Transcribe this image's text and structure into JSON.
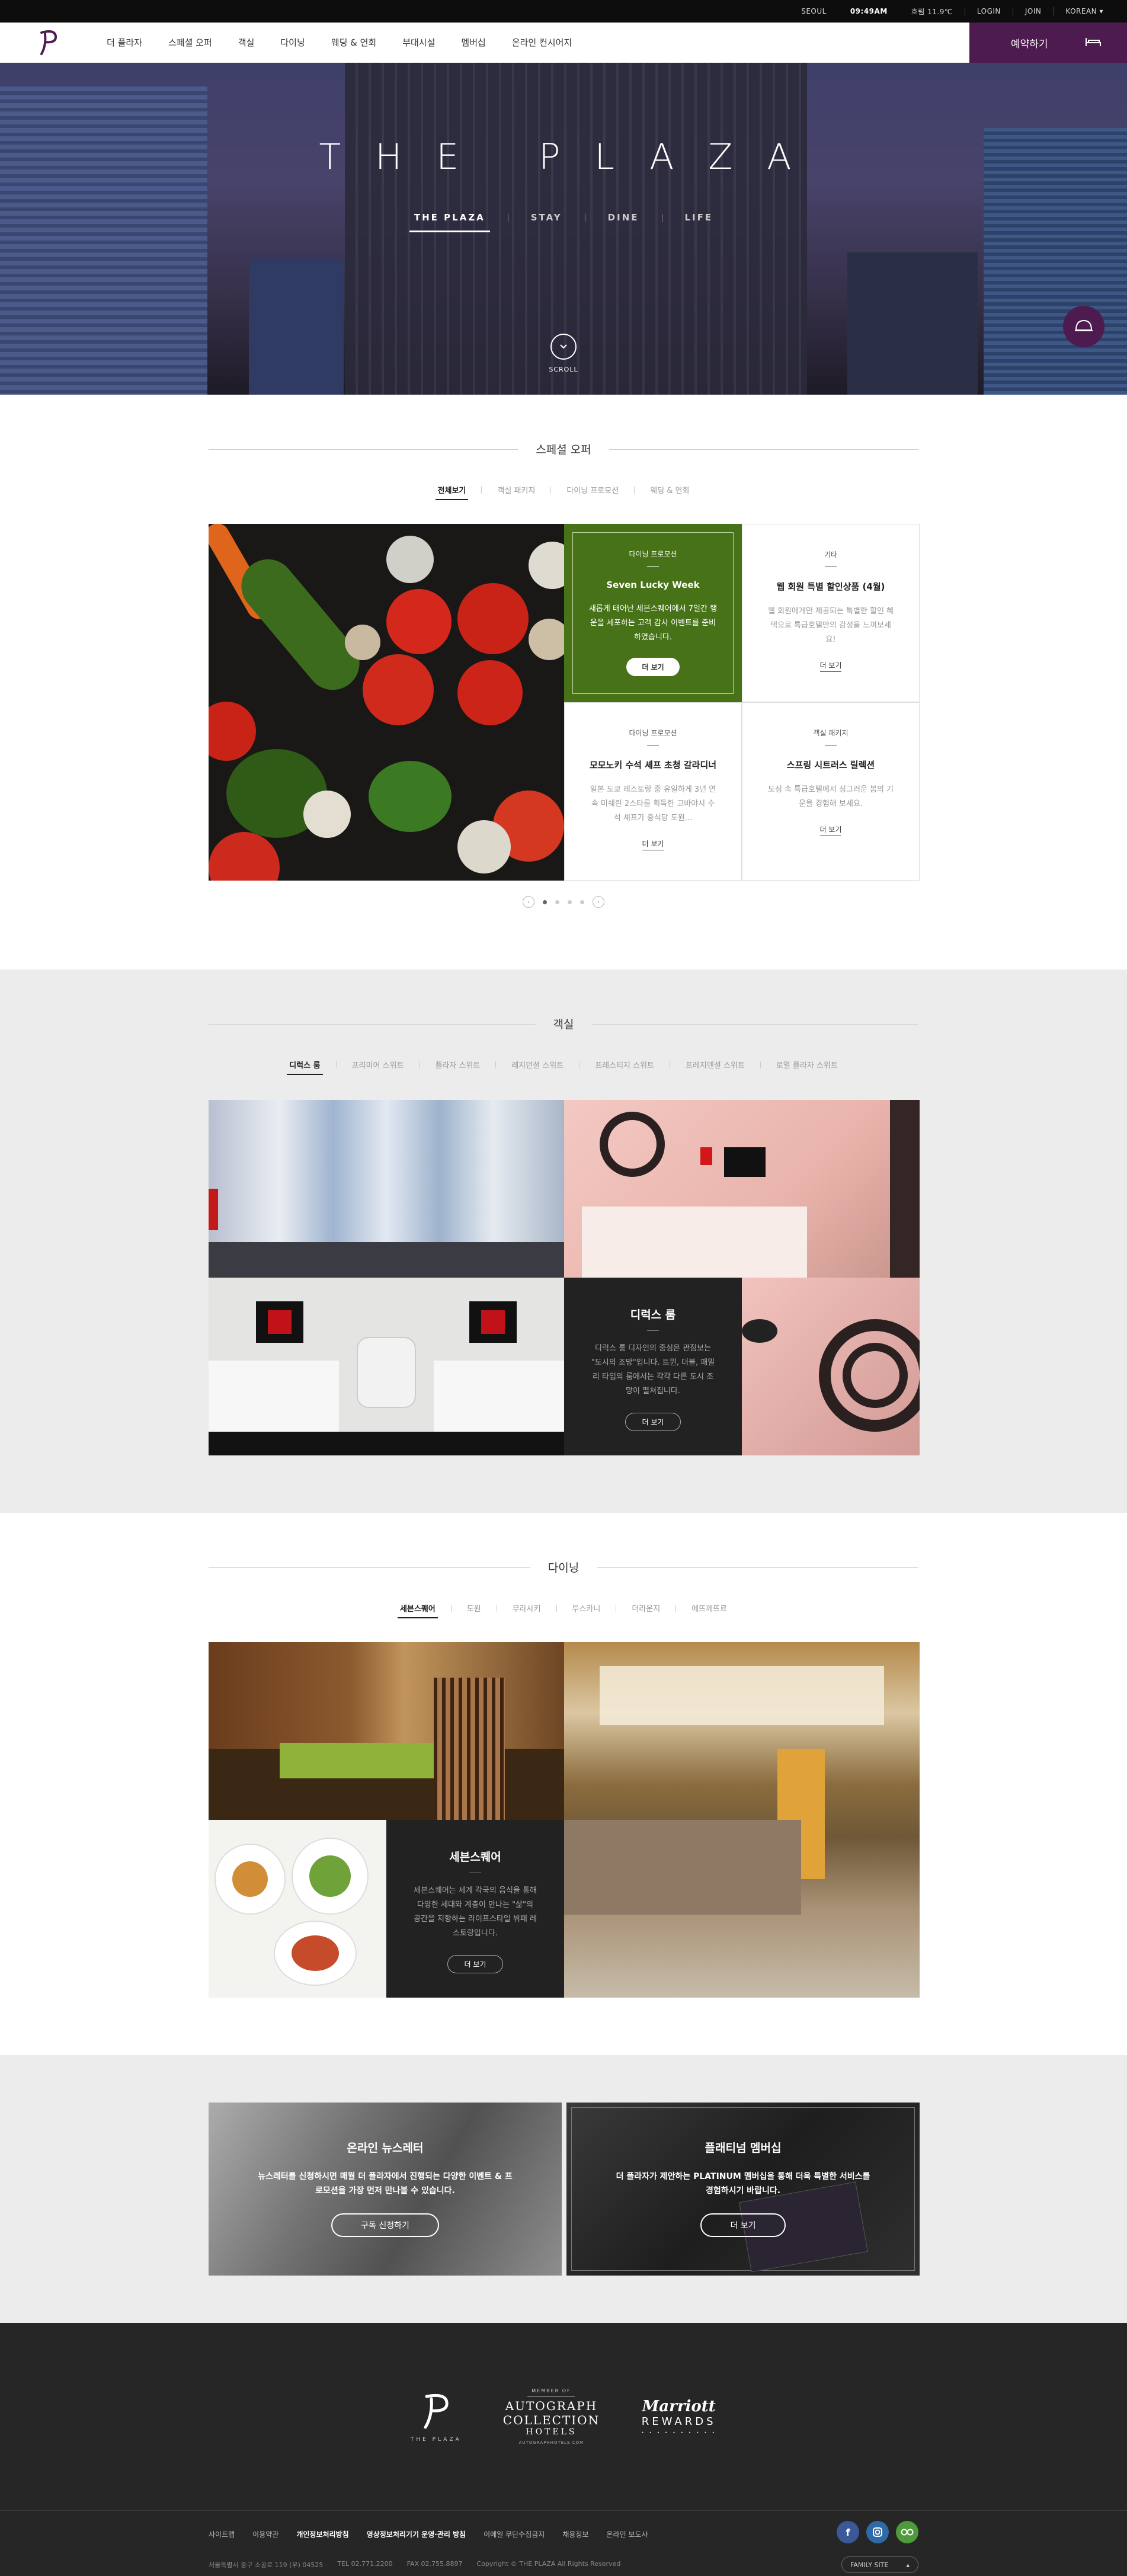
{
  "topbar": {
    "city": "SEOUL",
    "time": "09:49AM",
    "weather": "흐림 11.9℃",
    "login": "LOGIN",
    "join": "JOIN",
    "language": "KOREAN"
  },
  "nav": {
    "items": [
      "더 플라자",
      "스페셜 오퍼",
      "객실",
      "다이닝",
      "웨딩 & 연회",
      "부대시설",
      "멤버십",
      "온라인 컨시어지"
    ],
    "reserve_label": "예약하기"
  },
  "hero": {
    "title": "THE PLAZA",
    "tabs": [
      "THE PLAZA",
      "STAY",
      "DINE",
      "LIFE"
    ],
    "active_tab": "THE PLAZA",
    "scroll_label": "SCROLL"
  },
  "special_offer": {
    "title": "스페셜 오퍼",
    "filters": [
      "전체보기",
      "객실 패키지",
      "다이닝 프로모션",
      "웨딩 & 연회"
    ],
    "active_filter": "전체보기",
    "cards": [
      {
        "category": "다이닝 프로모션",
        "name": "Seven Lucky Week",
        "desc": "새롭게 태어난 세븐스퀘어에서 7일간 행운을 세포하는 고객 감사 이벤트를 준비하였습니다.",
        "more": "더 보기"
      },
      {
        "category": "기타",
        "name": "웹 회원 특별 할인상품 (4월)",
        "desc": "웹 회원에게만 제공되는 특별한 할인 혜택으로 특급호텔만의 감성을 느껴보세요!",
        "more": "더 보기"
      },
      {
        "category": "다이닝 프로모션",
        "name": "모모노키 수석 셰프 초청 갈라디너",
        "desc": "일본 도쿄 레스토랑 중 유일하게 3년 연속 미쉐린 2스타를 획득한 고바야시 수석 셰프가 중식당 도원...",
        "more": "더 보기"
      },
      {
        "category": "객실 패키지",
        "name": "스프링 시트러스 릴렉션",
        "desc": "도심 속 특급호텔에서 싱그러운 봄의 기운을 경험해 보세요.",
        "more": "더 보기"
      }
    ]
  },
  "rooms": {
    "title": "객실",
    "filters": [
      "디럭스 룸",
      "프리미어 스위트",
      "플라자 스위트",
      "레지던셜 스위트",
      "프레스티지 스위트",
      "프레지덴셜 스위트",
      "로열 플라자 스위트"
    ],
    "active_filter": "디럭스 룸",
    "card": {
      "name": "디럭스 룸",
      "desc": "디럭스 룸 디자인의 중심은 관점보는 \"도시의 조망\"입니다. 트윈, 더블, 패밀리 타입의 룸에서는 각각 다른 도시 조망이 펼쳐집니다.",
      "more": "더 보기"
    }
  },
  "dining": {
    "title": "다이닝",
    "filters": [
      "세븐스퀘어",
      "도원",
      "무라사키",
      "투스카니",
      "더라운지",
      "에뜨께뜨르"
    ],
    "active_filter": "세븐스퀘어",
    "card": {
      "name": "세븐스퀘어",
      "desc": "세븐스퀘어는 세계 각국의 음식을 통해 다양한 세대와 계층이 만나는 \"삶\"의 공간을 지향하는 라이프스타일 뷔페 레스토랑입니다.",
      "more": "더 보기"
    }
  },
  "promo": {
    "newsletter": {
      "name": "온라인 뉴스레터",
      "desc": "뉴스레터를 신청하시면 매월 더 플라자에서 진행되는 다양한 이벤트 & 프로모션을 가장 먼저 만나볼 수 있습니다.",
      "more": "구독 신청하기"
    },
    "membership": {
      "name": "플래티넘 멤버십",
      "desc": "더 플라자가 제안하는 PLATINUM 멤버십을 통해 더욱 특별한 서비스를 경험하시기 바랍니다.",
      "more": "더 보기"
    }
  },
  "footer": {
    "logo_plaza": "THE PLAZA",
    "autograph_member": "MEMBER OF",
    "autograph_l1": "AUTOGRAPH",
    "autograph_l2": "COLLECTION",
    "autograph_l3": "HOTELS",
    "autograph_url": "AUTOGRAPHHOTELS.COM",
    "marriott_l1": "Marriott",
    "marriott_l2": "REWARDS",
    "links": [
      "사이트맵",
      "이용약관",
      "개인정보처리방침",
      "영상정보처리기기 운영·관리 방침",
      "이메일 무단수집금지",
      "채용정보",
      "온라인 보도사"
    ],
    "bold_links": [
      "개인정보처리방침",
      "영상정보처리기기 운영·관리 방침"
    ],
    "address": "서울특별시 중구 소공로 119 (우) 04525",
    "tel": "TEL 02.771.2200",
    "fax": "FAX 02.755.8897",
    "copyright": "Copyright © THE PLAZA All Rights Reserved",
    "family_site": "FAMILY SITE",
    "colors": {
      "facebook": "#3b5998",
      "instagram": "#2f6aa6",
      "tripadvisor": "#4f9a3a"
    }
  }
}
